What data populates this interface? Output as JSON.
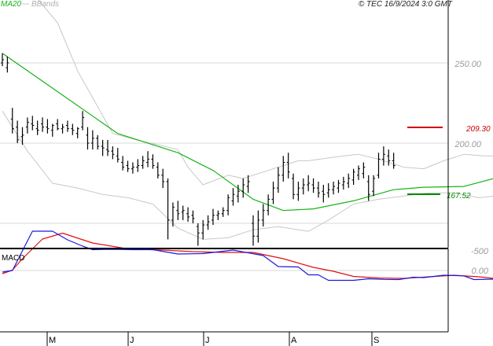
{
  "header": {
    "legend_ma": "MA20",
    "legend_bb": "BBands",
    "copyright": "© TEC 16/9/2024 3:0 GMT"
  },
  "colors": {
    "price": "#000000",
    "ma": "#19b319",
    "bbands": "#c8c8c8",
    "macd": "#1a1adc",
    "signal": "#e01010",
    "resistance": "#cc0000",
    "support": "#008800",
    "grid": "#d8d8d8"
  },
  "levels": {
    "resistance": {
      "label": "209.30",
      "value": 209.3
    },
    "support": {
      "label": "167.52",
      "value": 167.52
    }
  },
  "chart_data": [
    {
      "type": "ohlc",
      "title": "",
      "ylim": [
        145,
        265
      ],
      "y_ticks": [
        {
          "value": 250,
          "label": "250.00"
        },
        {
          "value": 200,
          "label": "200.00"
        }
      ],
      "x_ticks": [
        "M",
        "J",
        "J",
        "A",
        "S"
      ],
      "grid": true,
      "legend": "top-left",
      "series": [
        {
          "name": "price",
          "values": [
            [
              250,
              256,
              248,
              252
            ],
            [
              247,
              254,
              244,
              250
            ],
            [
              215,
              222,
              206,
              209
            ],
            [
              210,
              214,
              200,
              202
            ],
            [
              204,
              210,
              199,
              205
            ],
            [
              210,
              216,
              206,
              213
            ],
            [
              212,
              217,
              208,
              211
            ],
            [
              209,
              214,
              205,
              208
            ],
            [
              212,
              216,
              207,
              210
            ],
            [
              210,
              215,
              206,
              209
            ],
            [
              208,
              212,
              204,
              211
            ],
            [
              212,
              215,
              208,
              209
            ],
            [
              209,
              212,
              206,
              210
            ],
            [
              211,
              214,
              207,
              209
            ],
            [
              209,
              212,
              205,
              208
            ],
            [
              206,
              210,
              203,
              209
            ],
            [
              210,
              220,
              208,
              216
            ],
            [
              205,
              210,
              196,
              200
            ],
            [
              200,
              208,
              196,
              203
            ],
            [
              203,
              205,
              196,
              198
            ],
            [
              198,
              202,
              192,
              197
            ],
            [
              196,
              202,
              192,
              195
            ],
            [
              195,
              198,
              190,
              193
            ],
            [
              192,
              197,
              188,
              190
            ],
            [
              188,
              192,
              183,
              185
            ],
            [
              186,
              189,
              182,
              184
            ],
            [
              184,
              188,
              181,
              185
            ],
            [
              185,
              190,
              182,
              186
            ],
            [
              186,
              192,
              184,
              189
            ],
            [
              188,
              195,
              185,
              190
            ],
            [
              190,
              193,
              184,
              186
            ],
            [
              185,
              188,
              178,
              180
            ],
            [
              180,
              184,
              172,
              176
            ],
            [
              176,
              178,
              140,
              152
            ],
            [
              152,
              163,
              148,
              160
            ],
            [
              158,
              164,
              152,
              156
            ],
            [
              157,
              161,
              152,
              158
            ],
            [
              156,
              160,
              151,
              154
            ],
            [
              155,
              158,
              150,
              153
            ],
            [
              148,
              150,
              136,
              144
            ],
            [
              144,
              152,
              140,
              149
            ],
            [
              149,
              155,
              146,
              151
            ],
            [
              152,
              159,
              149,
              155
            ],
            [
              155,
              158,
              152,
              156
            ],
            [
              156,
              160,
              154,
              158
            ],
            [
              158,
              168,
              155,
              166
            ],
            [
              164,
              172,
              161,
              168
            ],
            [
              167,
              174,
              163,
              170
            ],
            [
              170,
              178,
              166,
              174
            ],
            [
              173,
              180,
              169,
              176
            ],
            [
              150,
              155,
              136,
              142
            ],
            [
              142,
              158,
              138,
              152
            ],
            [
              152,
              162,
              148,
              158
            ],
            [
              158,
              168,
              155,
              165
            ],
            [
              165,
              176,
              162,
              172
            ],
            [
              172,
              185,
              169,
              180
            ],
            [
              180,
              192,
              176,
              188
            ],
            [
              188,
              194,
              178,
              182
            ],
            [
              178,
              181,
              165,
              168
            ],
            [
              168,
              176,
              164,
              172
            ],
            [
              172,
              178,
              168,
              174
            ],
            [
              174,
              180,
              170,
              175
            ],
            [
              174,
              178,
              169,
              172
            ],
            [
              172,
              176,
              166,
              169
            ],
            [
              170,
              174,
              163,
              168
            ],
            [
              169,
              175,
              166,
              171
            ],
            [
              171,
              176,
              168,
              173
            ],
            [
              172,
              177,
              169,
              175
            ],
            [
              174,
              179,
              171,
              176
            ],
            [
              175,
              181,
              172,
              178
            ],
            [
              177,
              184,
              174,
              182
            ],
            [
              180,
              186,
              177,
              184
            ],
            [
              181,
              188,
              178,
              185
            ],
            [
              176,
              180,
              164,
              168
            ],
            [
              170,
              180,
              167,
              178
            ],
            [
              180,
              194,
              178,
              190
            ],
            [
              190,
              198,
              186,
              193
            ],
            [
              192,
              196,
              186,
              189
            ],
            [
              189,
              194,
              184,
              186
            ]
          ]
        },
        {
          "name": "MA20",
          "x": [
            0,
            11.5,
            23,
            35,
            42,
            50,
            56,
            62,
            70,
            78,
            84,
            92,
            98
          ],
          "values": [
            256,
            231,
            206,
            194,
            183,
            165,
            158,
            159,
            164,
            171,
            172.5,
            173,
            178
          ]
        },
        {
          "name": "BBands",
          "upper_x": [
            0,
            7,
            11,
            15,
            22,
            28,
            31,
            35,
            37,
            40,
            45,
            48,
            52,
            56,
            59,
            61,
            68,
            71,
            75,
            80,
            84,
            88,
            92,
            96,
            98
          ],
          "upper": [
            300,
            290,
            275,
            245,
            206,
            201,
            199,
            196,
            185,
            174,
            180,
            178,
            182,
            186,
            189,
            189,
            192,
            193,
            190,
            185,
            184,
            189,
            193,
            192,
            192
          ],
          "lower_x": [
            0,
            5,
            10,
            15,
            20,
            25,
            30,
            35,
            40,
            45,
            50,
            55,
            61,
            65,
            70,
            75,
            80,
            85,
            90,
            95,
            98
          ],
          "lower": [
            220,
            195,
            175,
            172,
            168,
            166,
            162,
            147,
            140,
            141,
            146,
            148,
            145,
            152,
            162,
            165,
            167,
            169,
            169,
            166,
            167
          ]
        }
      ]
    },
    {
      "type": "line",
      "title": "MACD",
      "ylim": [
        -1300,
        300
      ],
      "y_ticks": [
        {
          "value": 0,
          "label": "0.00"
        },
        {
          "value": -500,
          "label": "-500"
        }
      ],
      "grid": true,
      "series": [
        {
          "name": "MACD",
          "x": [
            0,
            2,
            4,
            6,
            10,
            13,
            16,
            18,
            22,
            26,
            30,
            35,
            40,
            46,
            52,
            55,
            59,
            61,
            63,
            65,
            70,
            73,
            76,
            79,
            82,
            84,
            88,
            92,
            94,
            98
          ],
          "values": [
            40,
            0,
            -500,
            -1000,
            -1000,
            -780,
            -620,
            -530,
            -540,
            -530,
            -530,
            -420,
            -430,
            -520,
            -380,
            -100,
            -90,
            110,
            110,
            250,
            250,
            210,
            225,
            230,
            170,
            180,
            120,
            135,
            230,
            220
          ]
        },
        {
          "name": "signal",
          "x": [
            0,
            2,
            4,
            8,
            12,
            18,
            25,
            32,
            38,
            44,
            50,
            56,
            62,
            66,
            70,
            75,
            80,
            85,
            90,
            95,
            98
          ],
          "values": [
            80,
            -10,
            -300,
            -800,
            -950,
            -700,
            -550,
            -520,
            -480,
            -460,
            -460,
            -300,
            -80,
            20,
            150,
            190,
            200,
            160,
            120,
            160,
            200
          ]
        }
      ]
    }
  ]
}
